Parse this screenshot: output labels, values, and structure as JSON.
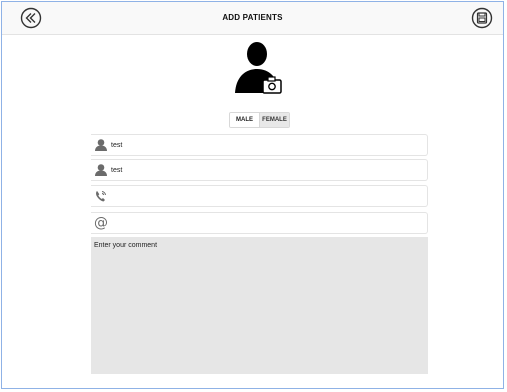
{
  "header": {
    "title": "ADD PATIENTS",
    "back_icon": "double-chevron-left-icon",
    "save_icon": "floppy-disk-icon"
  },
  "avatar": {
    "icon": "person-camera-icon"
  },
  "gender": {
    "male_label": "MALE",
    "female_label": "FEMALE",
    "selected": "MALE"
  },
  "fields": {
    "first_name": {
      "icon": "person-icon",
      "value": "test"
    },
    "last_name": {
      "icon": "person-icon",
      "value": "test"
    },
    "phone": {
      "icon": "phone-icon",
      "value": ""
    },
    "email": {
      "icon": "at-sign-icon",
      "value": ""
    }
  },
  "comment": {
    "placeholder": "Enter your comment"
  },
  "colors": {
    "frame_border": "#8fb2e6",
    "comment_bg": "#e6e6e6",
    "icon_gray": "#6b6b6b"
  }
}
